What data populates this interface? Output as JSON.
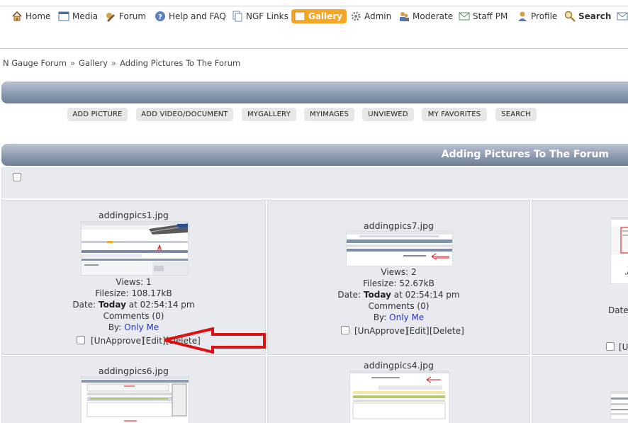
{
  "nav": {
    "items": [
      {
        "label": "Home",
        "icon": "home-icon"
      },
      {
        "label": "Media",
        "icon": "media-icon"
      },
      {
        "label": "Forum",
        "icon": "forum-icon"
      },
      {
        "label": "Help and FAQ",
        "icon": "help-icon"
      },
      {
        "label": "NGF Links",
        "icon": "links-icon"
      },
      {
        "label": "Gallery",
        "icon": "gallery-icon"
      },
      {
        "label": "Admin",
        "icon": "admin-icon"
      },
      {
        "label": "Moderate",
        "icon": "moderate-icon"
      },
      {
        "label": "Staff PM",
        "icon": "staff-pm-icon"
      },
      {
        "label": "Profile",
        "icon": "profile-icon"
      },
      {
        "label": "Search",
        "icon": "search-icon"
      }
    ],
    "active": "Gallery",
    "active_color": "#f5a623"
  },
  "breadcrumb": {
    "items": [
      "N Gauge Forum",
      "Gallery",
      "Adding Pictures To The Forum"
    ],
    "sep": "»"
  },
  "gallery_buttons": [
    "ADD PICTURE",
    "ADD VIDEO/DOCUMENT",
    "MYGALLERY",
    "MYIMAGES",
    "UNVIEWED",
    "MY FAVORITES",
    "SEARCH"
  ],
  "album_title": "Adding Pictures To The Forum",
  "pictures": [
    {
      "filename": "addingpics1.jpg",
      "views": "Views: 1",
      "filesize": "Filesize: 108.17kB",
      "date_prefix": "Date: ",
      "date_bold": "Today",
      "date_suffix": " at 02:54:14 pm",
      "comments": "Comments (0)",
      "by_prefix": "By: ",
      "by_link": "Only Me",
      "unapprove": "[UnApprove]",
      "edit": "[Edit]",
      "delete": "[Delete]"
    },
    {
      "filename": "addingpics7.jpg",
      "views": "Views: 2",
      "filesize": "Filesize: 52.67kB",
      "date_prefix": "Date: ",
      "date_bold": "Today",
      "date_suffix": " at 02:54:14 pm",
      "comments": "Comments (0)",
      "by_prefix": "By: ",
      "by_link": "Only Me",
      "unapprove": "[UnApprove]",
      "edit": "[Edit]",
      "delete": "[Delete]"
    },
    {
      "date_partial": "Date:",
      "unapprove_partial": "[Un"
    },
    {
      "filename": "addingpics6.jpg"
    },
    {
      "filename": "addingpics4.jpg"
    }
  ],
  "colors": {
    "link": "#2233cc",
    "header_bar": "#6c7d96",
    "annotation_arrow": "#dd1111"
  }
}
